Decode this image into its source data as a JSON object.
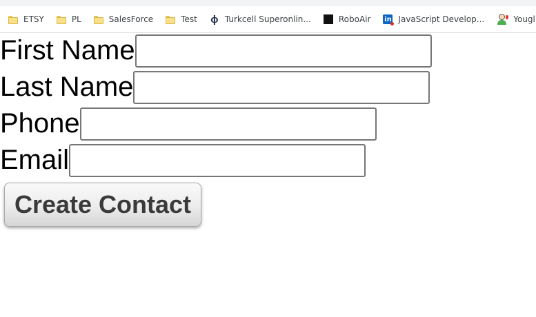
{
  "bookmarks": [
    {
      "label": "ETSY",
      "icon": "folder-icon"
    },
    {
      "label": "PL",
      "icon": "folder-icon"
    },
    {
      "label": "SalesForce",
      "icon": "folder-icon"
    },
    {
      "label": "Test",
      "icon": "folder-icon"
    },
    {
      "label": "Turkcell Superonlin...",
      "icon": "turkcell-icon"
    },
    {
      "label": "RoboAir",
      "icon": "roboair-icon"
    },
    {
      "label": "JavaScript Develop...",
      "icon": "linkedin-icon"
    },
    {
      "label": "Youglish",
      "icon": "youglish-icon"
    }
  ],
  "form": {
    "first_name_label": "First Name",
    "first_name_value": "",
    "last_name_label": "Last Name",
    "last_name_value": "",
    "phone_label": "Phone",
    "phone_value": "",
    "email_label": "Email",
    "email_value": "",
    "submit_label": "Create Contact"
  }
}
